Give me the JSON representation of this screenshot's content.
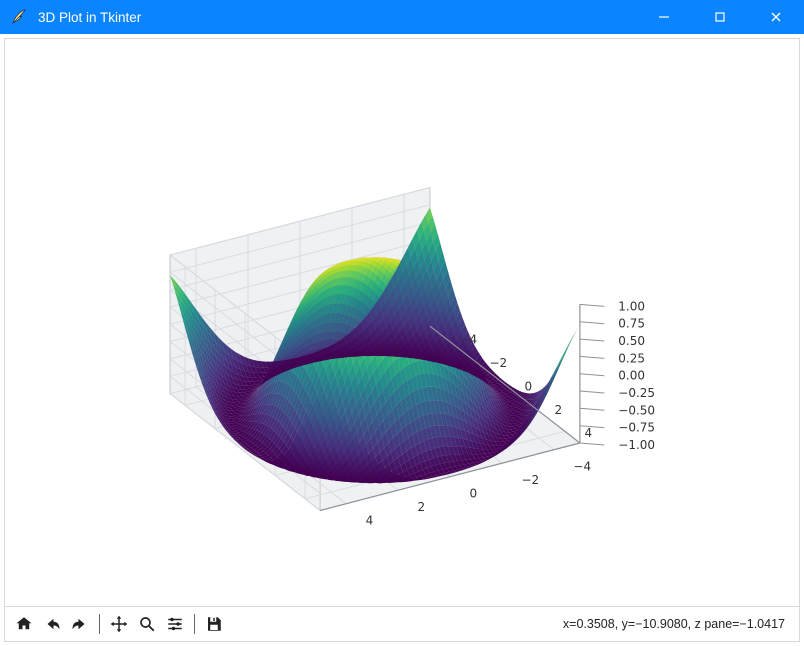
{
  "window": {
    "title": "3D Plot in Tkinter"
  },
  "toolbar": {
    "home_tip": "Home",
    "back_tip": "Back",
    "forward_tip": "Forward",
    "pan_tip": "Pan",
    "zoom_tip": "Zoom",
    "subplots_tip": "Configure subplots",
    "save_tip": "Save"
  },
  "status": {
    "text": "x=0.3508, y=−10.9080, z pane=−1.0417"
  },
  "chart_data": {
    "type": "surface",
    "description": "3D surface z = sin(sqrt(x^2 + y^2)) over [-5,5]^2, colored by z with viridis colormap",
    "x_range": [
      -5,
      5
    ],
    "y_range": [
      -5,
      5
    ],
    "z_range": [
      -1,
      1
    ],
    "x_ticks": [
      -4,
      -2,
      0,
      2,
      4
    ],
    "y_ticks": [
      -4,
      -2,
      0,
      2,
      4
    ],
    "z_ticks": [
      -1.0,
      -0.75,
      -0.5,
      -0.25,
      0.0,
      0.25,
      0.5,
      0.75,
      1.0
    ],
    "x_tick_labels": [
      "−4",
      "−2",
      "0",
      "2",
      "4"
    ],
    "y_tick_labels": [
      "−4",
      "−2",
      "0",
      "2",
      "4"
    ],
    "z_tick_labels": [
      "−1.00",
      "−0.75",
      "−0.50",
      "−0.25",
      "0.00",
      "0.25",
      "0.50",
      "0.75",
      "1.00"
    ],
    "colormap": "viridis",
    "colormap_stops": [
      [
        0.0,
        "#440154"
      ],
      [
        0.15,
        "#472f7d"
      ],
      [
        0.3,
        "#3a5489"
      ],
      [
        0.45,
        "#2c728e"
      ],
      [
        0.55,
        "#238a8d"
      ],
      [
        0.68,
        "#28ae80"
      ],
      [
        0.8,
        "#5ec962"
      ],
      [
        0.9,
        "#aadc32"
      ],
      [
        1.0,
        "#fde725"
      ]
    ]
  }
}
